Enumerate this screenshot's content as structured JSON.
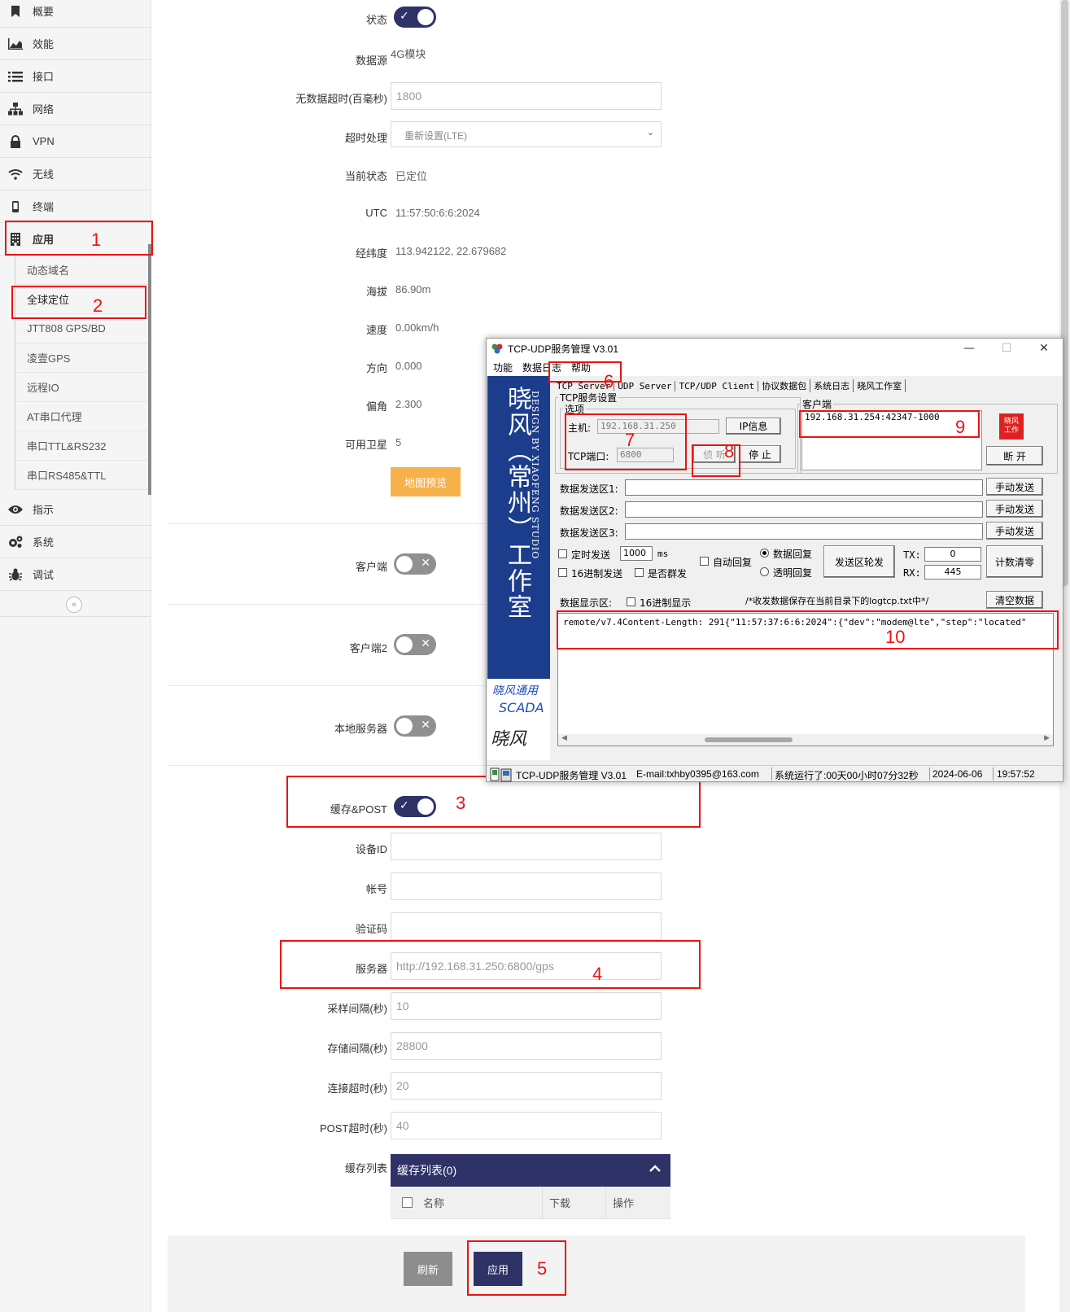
{
  "sidebar": {
    "items": [
      {
        "label": "概要",
        "icon": "bookmark-icon"
      },
      {
        "label": "效能",
        "icon": "area-chart-icon"
      },
      {
        "label": "接口",
        "icon": "list-icon"
      },
      {
        "label": "网络",
        "icon": "sitemap-icon"
      },
      {
        "label": "VPN",
        "icon": "lock-icon"
      },
      {
        "label": "无线",
        "icon": "wifi-icon"
      },
      {
        "label": "终端",
        "icon": "mobile-icon"
      },
      {
        "label": "应用",
        "icon": "building-icon"
      },
      {
        "label": "指示",
        "icon": "eye-icon"
      },
      {
        "label": "系统",
        "icon": "gears-icon"
      },
      {
        "label": "调试",
        "icon": "bug-icon"
      }
    ],
    "subitems": [
      "动态域名",
      "全球定位",
      "JTT808 GPS/BD",
      "凌壹GPS",
      "远程IO",
      "AT串口代理",
      "串口TTL&RS232",
      "串口RS485&TTL"
    ],
    "collapse_glyph": "«"
  },
  "form": {
    "status_label": "状态",
    "datasource_label": "数据源",
    "datasource_value": "4G模块",
    "nodata_timeout_label": "无数据超时(百毫秒)",
    "nodata_timeout_value": "1800",
    "timeout_handling_label": "超时处理",
    "timeout_handling_value": "重新设置(LTE)",
    "current_status_label": "当前状态",
    "current_status_value": "已定位",
    "utc_label": "UTC",
    "utc_value": "11:57:50:6:6:2024",
    "lnglat_label": "经纬度",
    "lnglat_value": "113.942122, 22.679682",
    "altitude_label": "海拔",
    "altitude_value": "86.90m",
    "speed_label": "速度",
    "speed_value": "0.00km/h",
    "direction_label": "方向",
    "direction_value": "0.000",
    "declination_label": "偏角",
    "declination_value": "2.300",
    "satellites_label": "可用卫星",
    "satellites_value": "5",
    "map_preview_label": "地图预览",
    "client_label": "客户端",
    "client2_label": "客户端2",
    "local_server_label": "本地服务器",
    "cache_post_label": "缓存&POST",
    "device_id_label": "设备ID",
    "account_label": "帐号",
    "verify_code_label": "验证码",
    "server_label": "服务器",
    "server_value": "http://192.168.31.250:6800/gps",
    "sample_interval_label": "采样间隔(秒)",
    "sample_interval_value": "10",
    "store_interval_label": "存储间隔(秒)",
    "store_interval_value": "28800",
    "connect_timeout_label": "连接超时(秒)",
    "connect_timeout_value": "20",
    "post_timeout_label": "POST超时(秒)",
    "post_timeout_value": "40",
    "cache_list_label": "缓存列表",
    "cache_table_title": "缓存列表(0)",
    "cache_cols": [
      "名称",
      "下载",
      "操作"
    ],
    "refresh_button": "刷新",
    "apply_button": "应用",
    "toggles": {
      "status": true,
      "client": false,
      "client2": false,
      "local_server": false,
      "cache_post": true
    },
    "toggle_on_glyph": "✓",
    "toggle_off_glyph": "✕",
    "chevron_glyph": "⌄"
  },
  "annotations": [
    "1",
    "2",
    "3",
    "4",
    "5",
    "6",
    "7",
    "8",
    "9",
    "10"
  ],
  "tool_window": {
    "title": "TCP-UDP服务管理 V3.01",
    "window_controls": [
      "—",
      "☐",
      "✕"
    ],
    "menu": [
      "功能",
      "数据日志",
      "帮助"
    ],
    "banner_text": "晓风（常州）工作室",
    "banner_sub": "DESIGN BY XIAOFENG STUDIO",
    "banner_scada_1": "晓风通用",
    "banner_scada_2": "SCADA",
    "banner_sig": "晓风",
    "tabs": [
      "TCP Server",
      "UDP Server",
      "TCP/UDP Client",
      "协议数据包",
      "系统日志",
      "晓风工作室"
    ],
    "tcp_group_label": "TCP服务设置",
    "options_label": "选项",
    "host_label": "主机:",
    "host_value": "192.168.31.250",
    "ip_info_button": "IP信息",
    "port_label": "TCP端口:",
    "port_value": "6800",
    "listen_button": "侦 听",
    "stop_button": "停 止",
    "client_group_label": "客户端",
    "client_entry": "192.168.31.254:42347-1000",
    "disconnect_button": "断 开",
    "send_area_1": "数据发送区1:",
    "send_area_2": "数据发送区2:",
    "send_area_3": "数据发送区3:",
    "manual_send": "手动发送",
    "timed_send": "定时发送",
    "timed_value": "1000",
    "ms": "ms",
    "hex_send": "16进制发送",
    "broadcast": "是否群发",
    "auto_reply": "自动回复",
    "data_reply": "数据回复",
    "transparent_reply": "透明回复",
    "rotate_send": "发送区轮发",
    "tx_label": "TX:",
    "tx_value": "0",
    "rx_label": "RX:",
    "rx_value": "445",
    "count_reset": "计数清零",
    "display_label": "数据显示区:",
    "hex_display": "16进制显示",
    "log_note": "/*收发数据保存在当前目录下的logtcp.txt中*/",
    "clear_button": "清空数据",
    "display_line": "remote/v7.4Content-Length: 291{\"11:57:37:6:6:2024\":{\"dev\":\"modem@lte\",\"step\":\"located\"",
    "status_bar": {
      "title": "TCP-UDP服务管理 V3.01",
      "email": "E-mail:txhby0395@163.com",
      "uptime": "系统运行了:00天00小时07分32秒",
      "date": "2024-06-06",
      "time": "19:57:52"
    },
    "seal": "晓风工作"
  }
}
